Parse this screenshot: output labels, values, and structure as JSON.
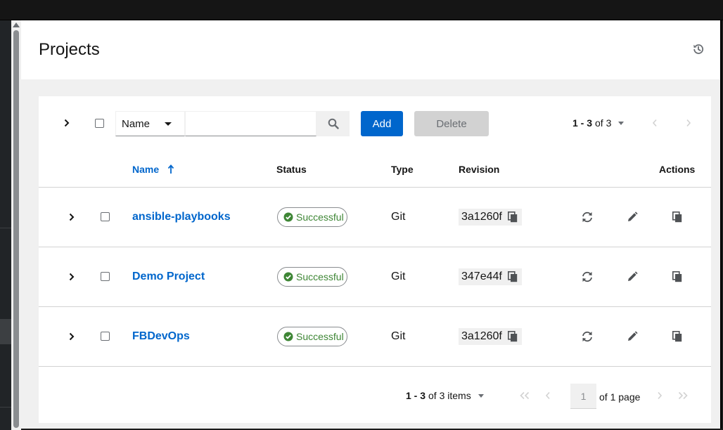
{
  "page": {
    "title": "Projects"
  },
  "toolbar": {
    "filter_field": "Name",
    "search_placeholder": "",
    "add_label": "Add",
    "delete_label": "Delete",
    "pager_range": "1 - 3",
    "pager_of": "of 3"
  },
  "table": {
    "headers": {
      "name": "Name",
      "status": "Status",
      "type": "Type",
      "revision": "Revision",
      "actions": "Actions"
    },
    "rows": [
      {
        "name": "ansible-playbooks",
        "status": "Successful",
        "type": "Git",
        "revision": "3a1260f"
      },
      {
        "name": "Demo Project",
        "status": "Successful",
        "type": "Git",
        "revision": "347e44f"
      },
      {
        "name": "FBDevOps",
        "status": "Successful",
        "type": "Git",
        "revision": "3a1260f"
      }
    ]
  },
  "footer": {
    "range": "1 - 3",
    "of_items": "of 3 items",
    "page_value": "1",
    "of_pages": "of 1 page"
  },
  "colors": {
    "accent": "#0066cc",
    "success": "#3e8635"
  },
  "icons": [
    "history-icon",
    "search-icon",
    "sort-asc-icon",
    "check-circle-icon",
    "copy-icon",
    "sync-icon",
    "pencil-icon",
    "chevron-right-icon",
    "chevron-left-icon",
    "double-chevron-icon"
  ]
}
